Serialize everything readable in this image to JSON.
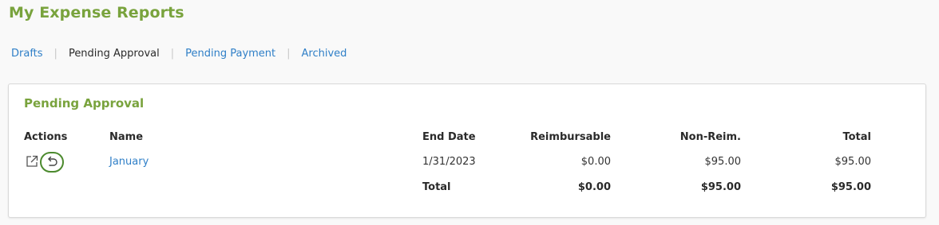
{
  "page": {
    "title": "My Expense Reports"
  },
  "tabs": [
    {
      "label": "Drafts",
      "active": false
    },
    {
      "label": "Pending Approval",
      "active": true
    },
    {
      "label": "Pending Payment",
      "active": false
    },
    {
      "label": "Archived",
      "active": false
    }
  ],
  "panel": {
    "title": "Pending Approval",
    "headers": {
      "actions": "Actions",
      "name": "Name",
      "end_date": "End Date",
      "reimbursable": "Reimbursable",
      "non_reim": "Non-Reim.",
      "total": "Total"
    },
    "rows": [
      {
        "icons": [
          "open-in-new-icon",
          "undo-recall-icon"
        ],
        "name": "January",
        "end_date": "1/31/2023",
        "reimbursable": "$0.00",
        "non_reim": "$95.00",
        "total": "$95.00"
      }
    ],
    "totals": {
      "label": "Total",
      "reimbursable": "$0.00",
      "non_reim": "$95.00",
      "total": "$95.00"
    }
  },
  "colors": {
    "title_green": "#79a33d",
    "link_blue": "#2f7fc7",
    "highlight_ring": "#4c8a2e"
  }
}
